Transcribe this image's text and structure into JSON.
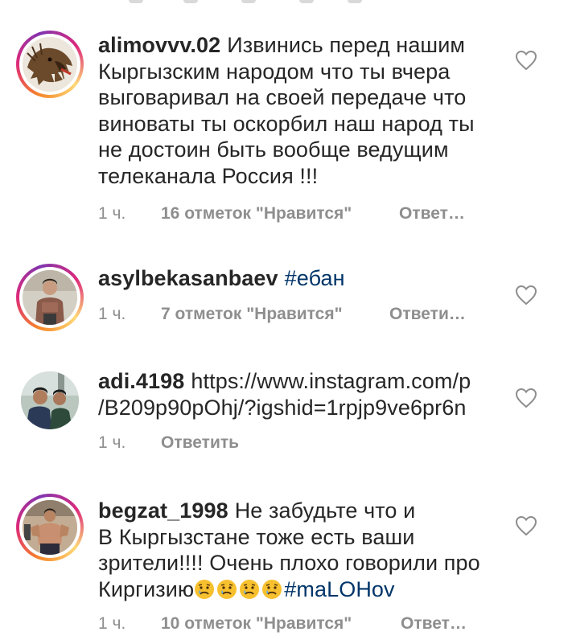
{
  "comments": [
    {
      "username": "alimovvv.02",
      "text_lines": [
        "Извинись перед нашим",
        "Кыргызским народом  что ты вчера",
        "выговаривал на своей передаче что",
        "виноваты ты оскорбил наш народ ты",
        "не достоин быть вообще ведущим",
        "телеканала Россия !!!"
      ],
      "time": "1 ч.",
      "likes": "16 отметок \"Нравится\"",
      "reply": "Ответ…",
      "avatar_icon": "boar-logo-avatar",
      "story_ring": true
    },
    {
      "username": "asylbekasanbaev",
      "hashtag": "#ебан",
      "time": "1 ч.",
      "likes": "7 отметок \"Нравится\"",
      "reply": "Ответи…",
      "avatar_icon": "person-photo-avatar",
      "story_ring": true
    },
    {
      "username": "adi.4198",
      "text_first": "https://www.instagram.com/p",
      "text_second": "/B209p90pOhj/?igshid=1rpjp9ve6pr6n",
      "time": "1 ч.",
      "reply": "Ответить",
      "avatar_icon": "group-photo-avatar",
      "story_ring": false
    },
    {
      "username": "begzat_1998",
      "text_lines": [
        "Не забудьте что и",
        "В Кыргызстане тоже есть ваши",
        "зрители!!!! Очень плохо говорили про",
        "Киргизию"
      ],
      "emojis": [
        "crying-face-emoji",
        "crying-face-emoji",
        "crying-face-emoji",
        "crying-face-emoji"
      ],
      "hashtag": "#maLOHov",
      "time": "1 ч.",
      "likes": "10 отметок \"Нравится\"",
      "reply": "Ответ…",
      "avatar_icon": "gym-photo-avatar",
      "story_ring": true
    }
  ],
  "colors": {
    "text": "#262626",
    "meta": "#8e8e8e",
    "hashtag": "#003569",
    "heart_stroke": "#8e8e8e"
  },
  "heart_icon": "heart-outline-icon"
}
